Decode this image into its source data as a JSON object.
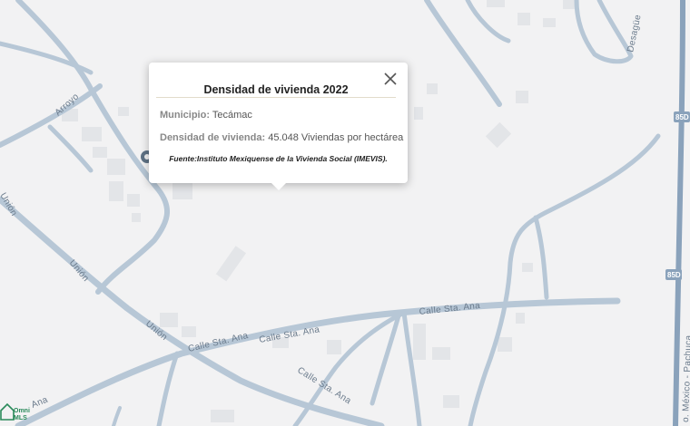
{
  "popup": {
    "title": "Densidad de vivienda 2022",
    "municipio_label": "Municipio:",
    "municipio_value": "Tecámac",
    "densidad_label": "Densidad de vivienda:",
    "densidad_value": "45.048 Viviendas por hectárea",
    "source": "Fuente:Instituto Mexiquense de la Vivienda Social (IMEVIS).",
    "close_icon": "close-icon"
  },
  "map": {
    "road_labels": {
      "arroyo": "Arroyo",
      "desague": "Desagüe",
      "union_upper": "Unión",
      "union_mid": "Unión",
      "union_lower": "Unión",
      "ana_left": "Ana",
      "calle_sta_ana_1": "Calle Sta. Ana",
      "calle_sta_ana_2": "Calle Sta. Ana",
      "calle_sta_ana_3": "Calle Sta. Ana",
      "calle_sta_ana_4": "Calle Sta. Ana",
      "highway": "o. México - Pachuca"
    },
    "shields": [
      "85D",
      "85D"
    ],
    "logo_text": "Omni",
    "logo_sub": "MLS"
  }
}
